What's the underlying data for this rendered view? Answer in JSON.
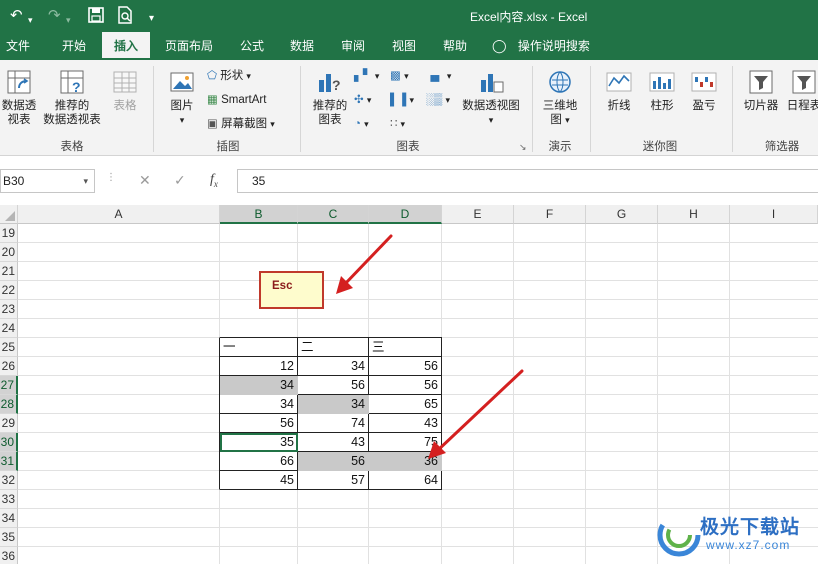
{
  "window": {
    "title": "Excel内容.xlsx  -  Excel"
  },
  "tabs": [
    {
      "label": "文件",
      "active": false
    },
    {
      "label": "开始",
      "active": false
    },
    {
      "label": "插入",
      "active": true
    },
    {
      "label": "页面布局",
      "active": false
    },
    {
      "label": "公式",
      "active": false
    },
    {
      "label": "数据",
      "active": false
    },
    {
      "label": "审阅",
      "active": false
    },
    {
      "label": "视图",
      "active": false
    },
    {
      "label": "帮助",
      "active": false
    }
  ],
  "tell_me": "操作说明搜索",
  "ribbon": {
    "pivot_table": "数据透\n视表",
    "recommended_pivot": "推荐的\n数据透视表",
    "table": "表格",
    "pictures": "图片",
    "shapes": "形状",
    "smartart": "SmartArt",
    "screenshot": "屏幕截图",
    "recommended_charts": "推荐的\n图表",
    "pivot_chart": "数据透视图",
    "map_3d": "三维地\n图",
    "sparkline_line": "折线",
    "sparkline_column": "柱形",
    "sparkline_winloss": "盈亏",
    "slicer": "切片器",
    "timeline": "日程表",
    "groups": {
      "tables": "表格",
      "illustrations": "插图",
      "charts": "图表",
      "tours": "演示",
      "sparklines": "迷你图",
      "filters": "筛选器"
    }
  },
  "formula_bar": {
    "name_box": "B30",
    "value": "35"
  },
  "columns": [
    "A",
    "B",
    "C",
    "D",
    "E",
    "F",
    "G",
    "H",
    "I"
  ],
  "rows": [
    "19",
    "20",
    "21",
    "22",
    "23",
    "24",
    "25",
    "26",
    "27",
    "28",
    "29",
    "30",
    "31",
    "32",
    "33",
    "34",
    "35",
    "36"
  ],
  "table": {
    "headers": [
      "一",
      "二",
      "三"
    ],
    "rows": [
      [
        "12",
        "34",
        "56"
      ],
      [
        "34",
        "56",
        "56"
      ],
      [
        "34",
        "34",
        "65"
      ],
      [
        "56",
        "74",
        "43"
      ],
      [
        "35",
        "43",
        "75"
      ],
      [
        "66",
        "56",
        "36"
      ],
      [
        "45",
        "57",
        "64"
      ]
    ]
  },
  "annotation": {
    "esc_label": "Esc"
  },
  "watermark": {
    "brand": "极光下载站",
    "url": "www.xz7.com"
  },
  "colors": {
    "excel_green": "#217346",
    "highlight_gray": "#c9c9c9",
    "arrow_red": "#d42020"
  }
}
